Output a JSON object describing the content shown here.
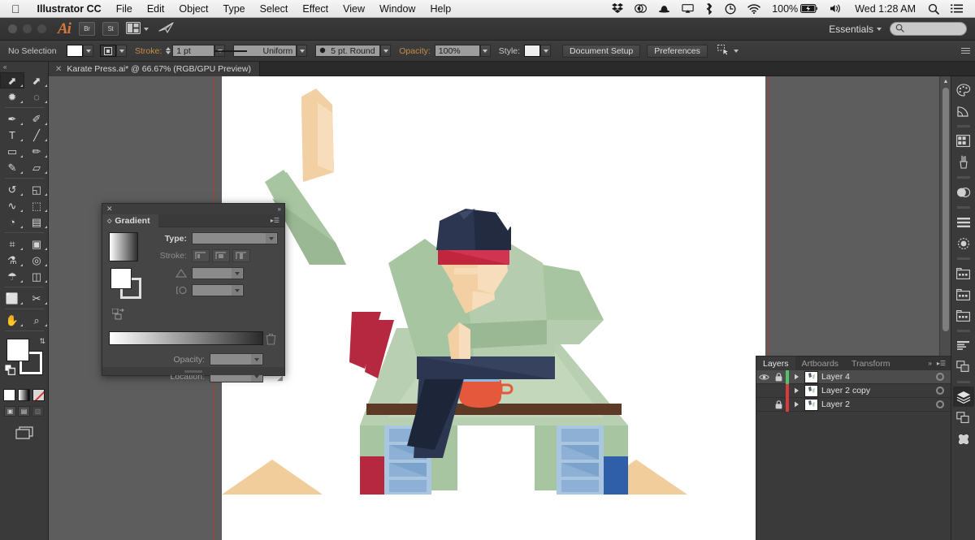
{
  "macbar": {
    "apple_icon": "apple-icon",
    "app_name": "Illustrator CC",
    "menus": [
      "File",
      "Edit",
      "Object",
      "Type",
      "Select",
      "Effect",
      "View",
      "Window",
      "Help"
    ],
    "status_icons": [
      "dropbox-icon",
      "creative-cloud-icon",
      "bowler-hat-icon",
      "airplay-icon",
      "bluetooth-icon",
      "time-machine-icon",
      "wifi-icon"
    ],
    "battery_percent": "100%",
    "battery_icon": "battery-charging-icon",
    "volume_icon": "volume-icon",
    "clock": "Wed 1:28 AM",
    "spotlight_icon": "search-icon",
    "notification_icon": "notification-center-icon"
  },
  "appbar": {
    "logo": "Ai",
    "bridge_label": "Br",
    "stock_label": "St",
    "arrange_icon": "arrange-documents-icon",
    "behance_icon": "behance-publish-icon",
    "workspace": "Essentials",
    "workspace_caret": "chevron-down-icon",
    "search_placeholder": "",
    "search_icon": "search-icon"
  },
  "controlbar": {
    "selection_status": "No Selection",
    "fill_swatch_color": "#ffffff",
    "stroke_label": "Stroke:",
    "stroke_weight": "1 pt",
    "variable_width_profile": "Uniform",
    "brush_definition": "5 pt. Round",
    "opacity_label": "Opacity:",
    "opacity_value": "100%",
    "style_label": "Style:",
    "document_setup_label": "Document Setup",
    "preferences_label": "Preferences",
    "select_similar_icon": "select-similar-objects-icon",
    "panel_menu_icon": "panel-menu-icon"
  },
  "document_tab": {
    "close_icon": "close-icon",
    "title": "Karate Press.ai* @ 66.67% (RGB/GPU Preview)"
  },
  "toolbar": {
    "collapse_icon": "double-chevron-left-icon",
    "tools": [
      {
        "name": "selection-tool",
        "glyph": "⬈",
        "selected": true
      },
      {
        "name": "direct-selection-tool",
        "glyph": "⬈",
        "selected": false
      },
      {
        "name": "magic-wand-tool",
        "glyph": "✹",
        "selected": false
      },
      {
        "name": "lasso-tool",
        "glyph": "◌",
        "selected": false
      },
      {
        "name": "pen-tool",
        "glyph": "✒",
        "selected": false
      },
      {
        "name": "curvature-tool",
        "glyph": "✐",
        "selected": false
      },
      {
        "name": "type-tool",
        "glyph": "T",
        "selected": false
      },
      {
        "name": "line-segment-tool",
        "glyph": "╱",
        "selected": false
      },
      {
        "name": "rectangle-tool",
        "glyph": "▭",
        "selected": false
      },
      {
        "name": "paintbrush-tool",
        "glyph": "✏",
        "selected": false
      },
      {
        "name": "pencil-tool",
        "glyph": "✎",
        "selected": false
      },
      {
        "name": "eraser-tool",
        "glyph": "▱",
        "selected": false
      },
      {
        "name": "rotate-tool",
        "glyph": "↺",
        "selected": false
      },
      {
        "name": "scale-tool",
        "glyph": "◱",
        "selected": false
      },
      {
        "name": "width-tool",
        "glyph": "∿",
        "selected": false
      },
      {
        "name": "free-transform-tool",
        "glyph": "⬚",
        "selected": false
      },
      {
        "name": "shape-builder-tool",
        "glyph": "◔",
        "selected": false
      },
      {
        "name": "perspective-grid-tool",
        "glyph": "▤",
        "selected": false
      },
      {
        "name": "mesh-tool",
        "glyph": "⌗",
        "selected": false
      },
      {
        "name": "gradient-tool",
        "glyph": "▣",
        "selected": false
      },
      {
        "name": "eyedropper-tool",
        "glyph": "⚗",
        "selected": false
      },
      {
        "name": "blend-tool",
        "glyph": "◎",
        "selected": false
      },
      {
        "name": "symbol-sprayer-tool",
        "glyph": "☂",
        "selected": false
      },
      {
        "name": "column-graph-tool",
        "glyph": "◫",
        "selected": false
      },
      {
        "name": "artboard-tool",
        "glyph": "⬜",
        "selected": false
      },
      {
        "name": "slice-tool",
        "glyph": "✂",
        "selected": false
      },
      {
        "name": "hand-tool",
        "glyph": "✋",
        "selected": false
      },
      {
        "name": "zoom-tool",
        "glyph": "⌕",
        "selected": false
      }
    ],
    "fill_color": "#ffffff",
    "stroke_color": "#ffffff",
    "swap_icon": "swap-fill-stroke-icon",
    "default_icon": "default-fill-stroke-icon",
    "modes": [
      "color-mode-icon",
      "gradient-mode-icon",
      "none-mode-icon"
    ],
    "screen_modes": [
      "normal-screen-mode-icon",
      "full-screen-menubar-icon",
      "full-screen-icon"
    ],
    "change_screen_mode_icon": "change-screen-mode-icon"
  },
  "gradient_panel": {
    "close_icon": "close-icon",
    "collapse_icon": "double-chevron-right-icon",
    "title": "Gradient",
    "menu_icon": "panel-menu-icon",
    "type_label": "Type:",
    "type_value": "",
    "stroke_label": "Stroke:",
    "stroke_options": [
      "gradient-within-stroke-icon",
      "gradient-along-stroke-icon",
      "gradient-across-stroke-icon"
    ],
    "angle_label": "angle-icon",
    "angle_value": "",
    "aspect_label": "aspect-ratio-icon",
    "aspect_value": "",
    "delete_stop_icon": "trash-icon",
    "opacity_label": "Opacity:",
    "opacity_value": "",
    "location_label": "Location:",
    "location_value": "",
    "gradient_start": "#ffffff",
    "gradient_end": "#2a2a2a",
    "resize_grip": "resize-grip-icon"
  },
  "layers_panel": {
    "tabs": [
      {
        "label": "Layers",
        "active": true
      },
      {
        "label": "Artboards",
        "active": false
      },
      {
        "label": "Transform",
        "active": false
      }
    ],
    "overflow_icon": "double-chevron-right-icon",
    "menu_icon": "panel-menu-icon",
    "rows": [
      {
        "name": "Layer 4",
        "visible": true,
        "locked": true,
        "color": "#52c16b",
        "selected": true,
        "eye_icon": "eye-icon",
        "lock_icon": "lock-icon",
        "expand_icon": "triangle-right-icon",
        "target_icon": "target-circle-icon"
      },
      {
        "name": "Layer 2 copy",
        "visible": false,
        "locked": false,
        "color": "#d93a3a",
        "selected": false,
        "eye_icon": "eye-icon",
        "lock_icon": "",
        "expand_icon": "triangle-right-icon",
        "target_icon": "target-circle-icon"
      },
      {
        "name": "Layer 2",
        "visible": false,
        "locked": true,
        "color": "#d93a3a",
        "selected": false,
        "eye_icon": "eye-icon",
        "lock_icon": "lock-icon",
        "expand_icon": "triangle-right-icon",
        "target_icon": "target-circle-icon"
      }
    ]
  },
  "right_dock": {
    "icons": [
      "color-panel-icon",
      "color-guide-panel-icon",
      "swatches-panel-icon",
      "brushes-panel-icon",
      "transparency-panel-icon",
      "align-panel-icon",
      "pathfinder-panel-icon",
      "artboards-panel-icon",
      "links-panel-icon",
      "asset-export-panel-icon",
      "character-panel-icon",
      "appearance-panel-icon",
      "layers-panel-icon",
      "symbols-panel-icon",
      "image-trace-panel-icon"
    ],
    "active_icon": "layers-panel-icon"
  },
  "canvas": {
    "artwork_title": "karate-press-illustration",
    "zoom_level": "66.67%",
    "guide_color": "#a6402f",
    "background_color": "#5d5d5d",
    "artboard_color": "#ffffff",
    "artwork_colors": {
      "gi": "#a8c5a2",
      "gi_shade": "#9bb894",
      "gi_light": "#c0d6b8",
      "skin": "#f2d0a4",
      "skin_light": "#f7ddbb",
      "belt_navy": "#2c3650",
      "headband_red": "#c0263e",
      "hair": "#2c3650",
      "red_accent": "#b5283f",
      "blue_accent": "#2f5fa8",
      "table_brown": "#5c3a26",
      "mug_orange": "#e5583c",
      "press_glass": "#8db8dd",
      "book_blue": "#a8c6e0",
      "sand": "#f0cd9b"
    }
  }
}
